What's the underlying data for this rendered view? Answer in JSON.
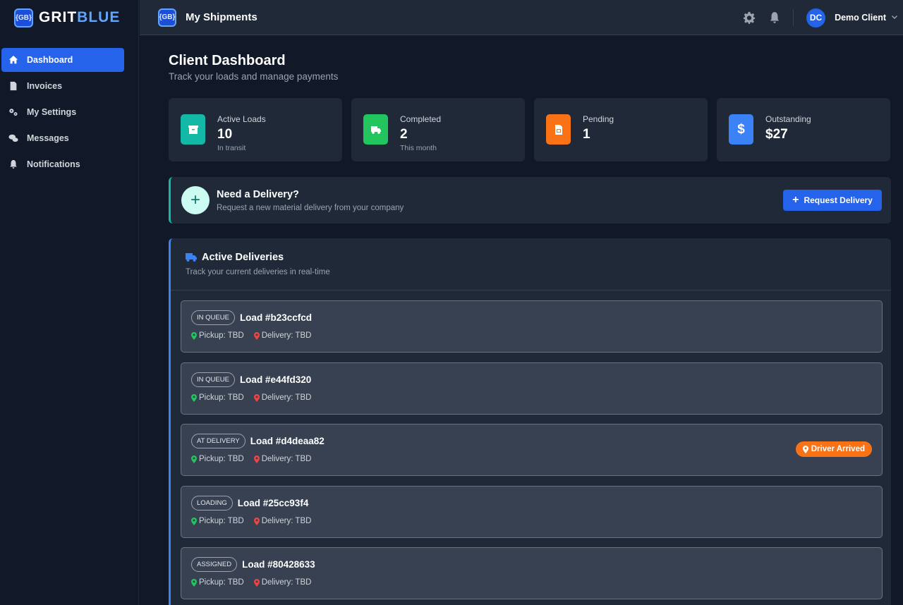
{
  "brand": {
    "logo_text": "{GB}",
    "name_part1": "GRIT",
    "name_part2": "BLUE"
  },
  "sidebar": {
    "items": [
      {
        "label": "Dashboard",
        "icon": "home-icon",
        "active": true
      },
      {
        "label": "Invoices",
        "icon": "file-icon"
      },
      {
        "label": "My Settings",
        "icon": "cogs-icon"
      },
      {
        "label": "Messages",
        "icon": "comments-icon"
      },
      {
        "label": "Notifications",
        "icon": "bell-icon"
      }
    ]
  },
  "topbar": {
    "logo_text": "{GB}",
    "title": "My Shipments",
    "user_initials": "DC",
    "user_name": "Demo Client"
  },
  "page": {
    "title": "Client Dashboard",
    "subtitle": "Track your loads and manage payments"
  },
  "stats": [
    {
      "label": "Active Loads",
      "value": "10",
      "sub": "In transit",
      "color": "#14b8a6",
      "icon": "box-icon"
    },
    {
      "label": "Completed",
      "value": "2",
      "sub": "This month",
      "color": "#22c55e",
      "icon": "truck-icon"
    },
    {
      "label": "Pending",
      "value": "1",
      "sub": "",
      "color": "#f97316",
      "icon": "invoice-icon"
    },
    {
      "label": "Outstanding",
      "value": "$27",
      "sub": "",
      "color": "#3b82f6",
      "icon": "dollar-icon"
    }
  ],
  "cta": {
    "title": "Need a Delivery?",
    "subtitle": "Request a new material delivery from your company",
    "button_label": "Request Delivery"
  },
  "deliveries": {
    "title": "Active Deliveries",
    "subtitle": "Track your current deliveries in real-time",
    "loads": [
      {
        "status": "IN QUEUE",
        "id": "Load #b23ccfcd",
        "pickup": "Pickup: TBD",
        "delivery": "Delivery: TBD",
        "badge": ""
      },
      {
        "status": "IN QUEUE",
        "id": "Load #e44fd320",
        "pickup": "Pickup: TBD",
        "delivery": "Delivery: TBD",
        "badge": ""
      },
      {
        "status": "AT DELIVERY",
        "id": "Load #d4deaa82",
        "pickup": "Pickup: TBD",
        "delivery": "Delivery: TBD",
        "badge": "Driver Arrived"
      },
      {
        "status": "LOADING",
        "id": "Load #25cc93f4",
        "pickup": "Pickup: TBD",
        "delivery": "Delivery: TBD",
        "badge": ""
      },
      {
        "status": "ASSIGNED",
        "id": "Load #80428633",
        "pickup": "Pickup: TBD",
        "delivery": "Delivery: TBD",
        "badge": ""
      }
    ]
  },
  "colors": {
    "pickup_pin": "#22c55e",
    "delivery_pin": "#ef4444",
    "accent": "#2563eb"
  }
}
